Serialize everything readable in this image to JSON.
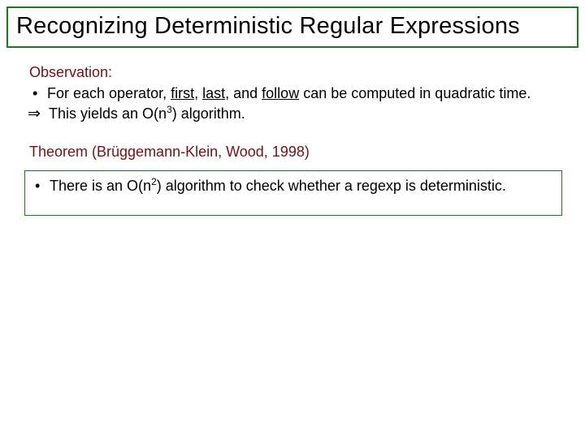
{
  "title": "Recognizing Deterministic Regular Expressions",
  "observation": {
    "label": "Observation:",
    "bullet_prefix": "For each operator, ",
    "term_first": "first",
    "sep1": ", ",
    "term_last": "last",
    "sep2": ", and ",
    "term_follow": "follow",
    "bullet_suffix": " can be computed in quadratic time.",
    "implies_symbol": "⇒",
    "implies_pre": "This yields an O(n",
    "implies_exp": "3",
    "implies_post": ") algorithm."
  },
  "theorem": {
    "label": "Theorem (Brüggemann-Klein, Wood, 1998)",
    "bullet_pre": "There is an O(n",
    "bullet_exp": "2",
    "bullet_post": ") algorithm to check whether a regexp is deterministic."
  },
  "bullet_char": "•"
}
